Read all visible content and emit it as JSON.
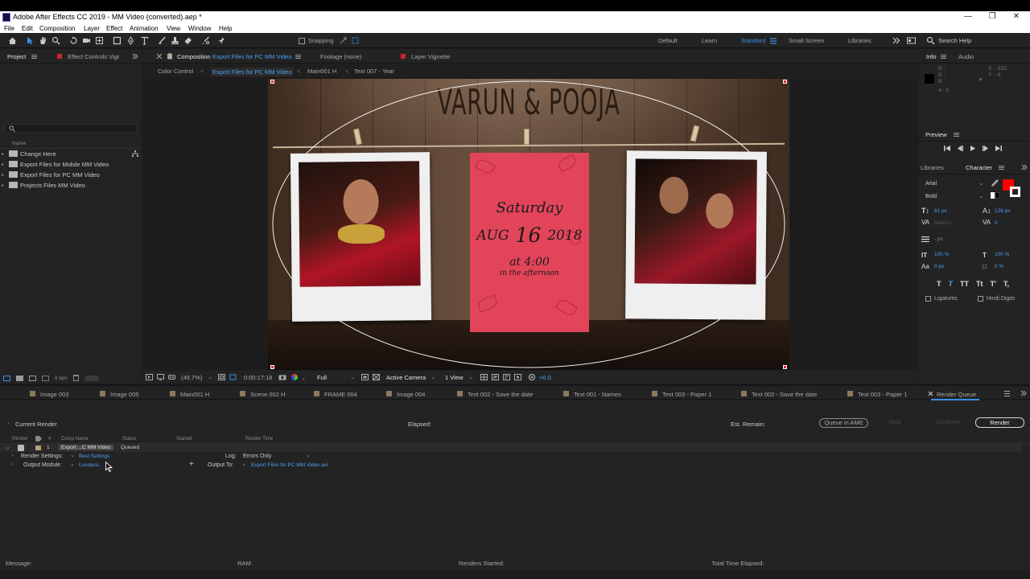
{
  "window": {
    "title": "Adobe After Effects CC 2019 - MM Video (converted).aep *"
  },
  "menu": [
    "File",
    "Edit",
    "Composition",
    "Layer",
    "Effect",
    "Animation",
    "View",
    "Window",
    "Help"
  ],
  "toolbar": {
    "snapping_label": "Snapping",
    "workspaces": [
      "Default",
      "Learn",
      "Standard",
      "Small Screen",
      "Libraries"
    ],
    "active_workspace": "Standard",
    "search_placeholder": "Search Help"
  },
  "project_panel": {
    "tab_label": "Project",
    "effect_controls_tab": "Effect Controls Vigr",
    "column_name": "Name",
    "items": [
      "Change Here",
      "Export Files for Mobile MM Video",
      "Export Files for PC MM Video",
      "Projects Files MM Video"
    ],
    "bpc": "8 bpc"
  },
  "comp_panel": {
    "tab_prefix": "Composition",
    "tab_comp_name": "Export Files for PC MM Video",
    "footage_tab": "Footage (none)",
    "layer_tab": "Layer Vignette",
    "breadcrumbs": [
      "Color Control",
      "Export Files for PC MM Video",
      "Main001 H",
      "Text 007 - Year"
    ],
    "zoom": "(49.7%)",
    "timecode": "0:00:17:18",
    "resolution": "Full",
    "camera": "Active Camera",
    "view": "1 View",
    "exposure": "+0.0"
  },
  "artwork": {
    "names": "VARUN & POOJA",
    "day": "Saturday",
    "month": "AUG",
    "date": "16",
    "year": "2018",
    "time": "at 4:00",
    "time_sub": "in the afternoon"
  },
  "info_panel": {
    "tab_info": "Info",
    "tab_audio": "Audio",
    "r": "R :",
    "g": "G :",
    "b": "B :",
    "a": "A : 0",
    "x": "X : -222",
    "y": "Y : -9"
  },
  "preview_panel": {
    "label": "Preview"
  },
  "character_panel": {
    "libraries_tab": "Libraries",
    "character_tab": "Character",
    "font": "Arial",
    "style": "Bold",
    "size": "81 px",
    "leading": "126 px",
    "kerning": "Metrics",
    "tracking": "0",
    "stroke": "- px",
    "vscale": "100 %",
    "hscale": "100 %",
    "baseline": "0 px",
    "tsume": "0 %",
    "ligatures": "Ligatures",
    "hindi_digits": "Hindi Digits",
    "fill_color": "#ff0000"
  },
  "queue_tabs": [
    "Image 003",
    "Image 005",
    "Main001 H",
    "Scene 002 H",
    "FRAME 004",
    "Image 004",
    "Text 002 - Save the date",
    "Text 001 - Names",
    "Text 003 - Paper 1",
    "Text 002 - Save the date",
    "Text 003 - Paper 1",
    "Render Queue"
  ],
  "render_queue": {
    "current_render": "Current Render",
    "elapsed": "Elapsed:",
    "est_remain": "Est. Remain:",
    "queue_ame": "Queue in AME",
    "stop": "Stop",
    "continue": "Continue",
    "render": "Render",
    "columns": [
      "Render",
      "#",
      "Comp Name",
      "Status",
      "Started",
      "Render Time"
    ],
    "item": {
      "number": "1",
      "comp_name": "Export ...C MM Video",
      "status": "Queued"
    },
    "render_settings_label": "Render Settings:",
    "render_settings_value": "Best Settings",
    "log_label": "Log:",
    "log_value": "Errors Only",
    "output_module_label": "Output Module:",
    "output_module_value": "Lossless",
    "output_to_label": "Output To:",
    "output_to_value": "Export Files for PC MM Video.avi"
  },
  "status_bar": {
    "message": "Message:",
    "ram": "RAM:",
    "renders_started": "Renders Started:",
    "total_time": "Total Time Elapsed:"
  }
}
